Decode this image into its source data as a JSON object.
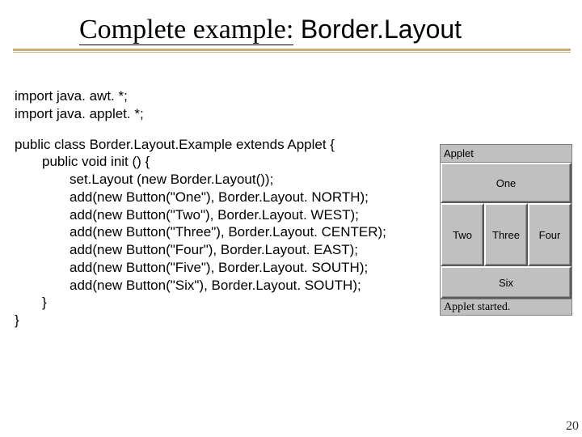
{
  "title": {
    "part1": "Complete example:",
    "part2": "Border.Layout"
  },
  "imports": {
    "line1": "import java. awt. *;",
    "line2": "import java. applet. *;"
  },
  "code": {
    "l1": "public class Border.Layout.Example extends Applet {",
    "l2": "public void init () {",
    "l3": "set.Layout (new Border.Layout());",
    "l4": "add(new Button(\"One\"), Border.Layout. NORTH);",
    "l5": "add(new Button(\"Two\"), Border.Layout. WEST);",
    "l6": "add(new Button(\"Three\"), Border.Layout. CENTER);",
    "l7": "add(new Button(\"Four\"), Border.Layout. EAST);",
    "l8": "add(new Button(\"Five\"), Border.Layout. SOUTH);",
    "l9": "add(new Button(\"Six\"), Border.Layout. SOUTH);",
    "l10": "}",
    "l11": "}"
  },
  "applet": {
    "title": "Applet",
    "north": "One",
    "west": "Two",
    "center": "Three",
    "east": "Four",
    "south": "Six",
    "status": "Applet started."
  },
  "page": "20"
}
